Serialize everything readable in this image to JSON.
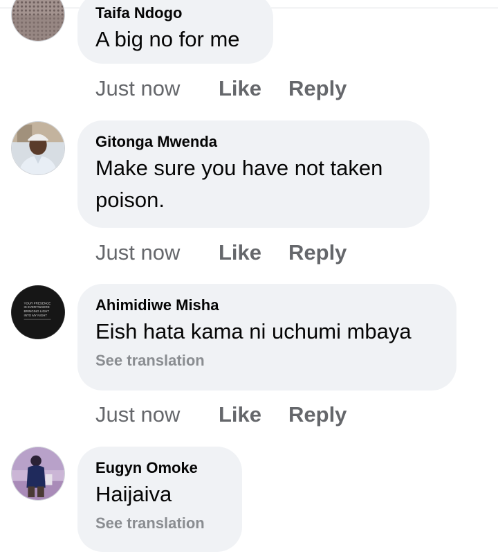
{
  "comments": [
    {
      "author": "Taifa Ndogo",
      "text": "A big no for me",
      "time": "Just now",
      "like_label": "Like",
      "reply_label": "Reply"
    },
    {
      "author": "Gitonga Mwenda",
      "text": "Make sure  you have not taken poison.",
      "time": "Just now",
      "like_label": "Like",
      "reply_label": "Reply"
    },
    {
      "author": "Ahimidiwe Misha",
      "text": "Eish hata kama ni uchumi mbaya",
      "see_translation": "See translation",
      "time": "Just now",
      "like_label": "Like",
      "reply_label": "Reply",
      "avatar_text": [
        "YOUR PRESENCE",
        "IS EVERYWHERE",
        "BRINGING LIGHT",
        "INTO MY NIGHT"
      ]
    },
    {
      "author": "Eugyn Omoke",
      "text": "Haijaiva",
      "see_translation": "See translation"
    }
  ]
}
